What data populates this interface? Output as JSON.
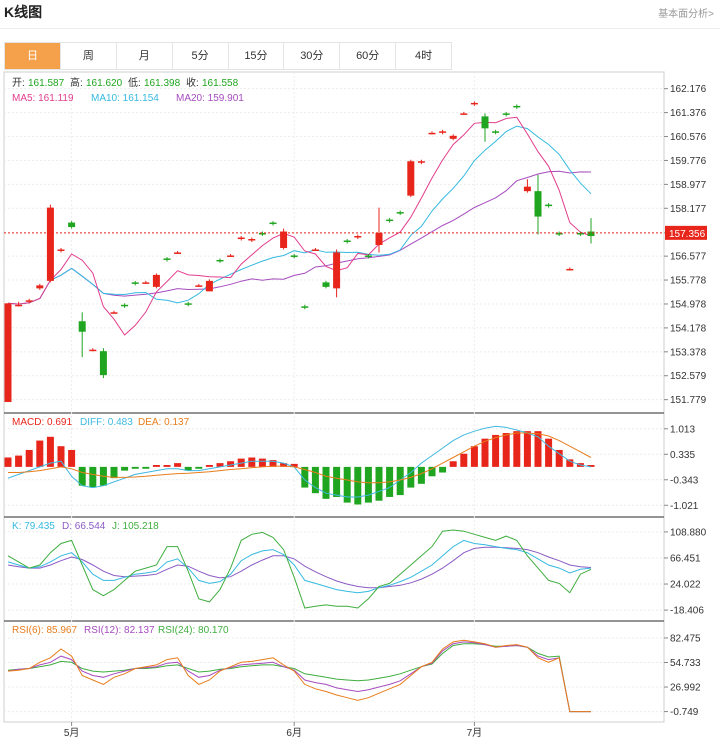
{
  "header": {
    "title": "K线图",
    "basic_link": "基本面分析>"
  },
  "tabs": [
    {
      "label": "日",
      "active": true
    },
    {
      "label": "周",
      "active": false
    },
    {
      "label": "月",
      "active": false
    },
    {
      "label": "5分",
      "active": false
    },
    {
      "label": "15分",
      "active": false
    },
    {
      "label": "30分",
      "active": false
    },
    {
      "label": "60分",
      "active": false
    },
    {
      "label": "4时",
      "active": false
    }
  ],
  "colors": {
    "up": "#e8251b",
    "down": "#1fa51f",
    "ma5": "#e23d8e",
    "ma10": "#35b9e0",
    "ma20": "#a64cbf",
    "macd": "#e8251b",
    "diff": "#3fb8e0",
    "dea": "#e87d1c",
    "k": "#35b9e0",
    "d": "#8b5bc4",
    "j": "#3fae3f",
    "rsi6": "#e87d1c",
    "rsi12": "#a64cbf",
    "rsi24": "#3fae3f"
  },
  "chart_data": [
    {
      "type": "candlestick",
      "legend_ohlc": {
        "open_label": "开:",
        "open": "161.587",
        "high_label": "高:",
        "high": "161.620",
        "low_label": "低:",
        "low": "161.398",
        "close_label": "收:",
        "close": "161.558"
      },
      "legend_ma": [
        {
          "label": "MA5: 161.119"
        },
        {
          "label": "MA10: 161.154"
        },
        {
          "label": "MA20: 159.901"
        }
      ],
      "y_ticks": [
        "162.176",
        "161.376",
        "160.576",
        "159.776",
        "158.977",
        "158.177",
        "157.356",
        "156.577",
        "155.778",
        "154.978",
        "154.178",
        "153.378",
        "152.579",
        "151.779"
      ],
      "y_tick_values": [
        162.176,
        161.376,
        160.576,
        159.776,
        158.977,
        158.177,
        157.356,
        156.577,
        155.778,
        154.978,
        154.178,
        153.378,
        152.579,
        151.779
      ],
      "current_price": 157.356,
      "ylim": [
        151.5,
        162.6
      ],
      "x_ticks": [
        {
          "label": "5月",
          "index": 6
        },
        {
          "label": "6月",
          "index": 27
        },
        {
          "label": "7月",
          "index": 44
        }
      ],
      "candles": [
        [
          151.7,
          155.0,
          151.7,
          155.0
        ],
        [
          154.95,
          154.95,
          154.9,
          155.05
        ],
        [
          155.05,
          155.1,
          155.0,
          155.15
        ],
        [
          155.5,
          155.6,
          155.45,
          155.65
        ],
        [
          155.75,
          158.2,
          155.7,
          158.3
        ],
        [
          156.75,
          156.8,
          156.7,
          156.85
        ],
        [
          157.7,
          157.55,
          157.5,
          157.75
        ],
        [
          154.4,
          154.05,
          153.2,
          154.7
        ],
        [
          153.4,
          153.45,
          153.4,
          153.5
        ],
        [
          153.4,
          152.6,
          152.5,
          153.5
        ],
        [
          154.65,
          154.7,
          154.65,
          154.75
        ],
        [
          154.95,
          154.9,
          154.85,
          155.0
        ],
        [
          155.7,
          155.65,
          155.6,
          155.75
        ],
        [
          155.65,
          155.7,
          155.65,
          155.75
        ],
        [
          155.55,
          155.95,
          155.5,
          156.0
        ],
        [
          156.5,
          156.45,
          156.4,
          156.55
        ],
        [
          156.65,
          156.7,
          156.65,
          156.75
        ],
        [
          155.0,
          154.95,
          154.9,
          155.05
        ],
        [
          155.55,
          155.6,
          155.55,
          155.65
        ],
        [
          155.4,
          155.75,
          155.4,
          155.8
        ],
        [
          156.45,
          156.4,
          156.35,
          156.5
        ],
        [
          156.55,
          156.6,
          156.55,
          156.65
        ],
        [
          157.15,
          157.2,
          157.1,
          157.25
        ],
        [
          157.1,
          157.15,
          157.05,
          157.2
        ],
        [
          157.35,
          157.3,
          157.25,
          157.4
        ],
        [
          157.7,
          157.65,
          157.6,
          157.75
        ],
        [
          156.85,
          157.4,
          156.8,
          157.5
        ],
        [
          156.6,
          156.55,
          156.5,
          156.65
        ],
        [
          154.9,
          154.85,
          154.8,
          154.95
        ],
        [
          156.75,
          156.8,
          156.75,
          156.85
        ],
        [
          155.7,
          155.55,
          155.5,
          155.75
        ],
        [
          155.5,
          156.7,
          155.2,
          156.8
        ],
        [
          157.1,
          157.05,
          157.0,
          157.15
        ],
        [
          157.2,
          157.25,
          157.15,
          157.3
        ],
        [
          156.6,
          156.55,
          156.5,
          156.65
        ],
        [
          156.95,
          157.35,
          156.7,
          158.2
        ],
        [
          157.8,
          157.75,
          157.7,
          157.85
        ],
        [
          158.05,
          158.0,
          157.95,
          158.1
        ],
        [
          158.6,
          159.75,
          158.55,
          159.8
        ],
        [
          159.7,
          159.75,
          159.65,
          159.8
        ],
        [
          160.65,
          160.7,
          160.65,
          160.75
        ],
        [
          160.7,
          160.75,
          160.65,
          160.8
        ],
        [
          160.5,
          160.6,
          160.45,
          160.65
        ],
        [
          161.3,
          161.35,
          161.3,
          161.4
        ],
        [
          161.65,
          161.7,
          161.6,
          161.75
        ],
        [
          161.25,
          160.85,
          160.4,
          161.35
        ],
        [
          160.75,
          160.7,
          160.65,
          160.8
        ],
        [
          161.35,
          161.3,
          161.25,
          161.4
        ],
        [
          161.6,
          161.55,
          161.5,
          161.65
        ],
        [
          158.75,
          158.9,
          158.7,
          159.15
        ],
        [
          158.75,
          157.9,
          157.3,
          159.3
        ],
        [
          158.3,
          158.25,
          158.2,
          158.35
        ],
        [
          157.35,
          157.3,
          157.25,
          157.4
        ],
        [
          156.15,
          156.15,
          156.1,
          156.2
        ],
        [
          157.35,
          157.3,
          157.25,
          157.4
        ],
        [
          157.4,
          157.25,
          157.0,
          157.85
        ]
      ]
    },
    {
      "type": "macd",
      "legend": [
        {
          "label": "MACD: 0.691"
        },
        {
          "label": "DIFF: 0.483"
        },
        {
          "label": "DEA: 0.137"
        }
      ],
      "y_ticks": [
        "1.013",
        "0.335",
        "-0.343",
        "-1.021"
      ],
      "y_tick_values": [
        1.013,
        0.335,
        -0.343,
        -1.021
      ],
      "ylim": [
        -1.2,
        1.3
      ],
      "macd": [
        0.25,
        0.3,
        0.45,
        0.7,
        0.8,
        0.55,
        0.45,
        -0.5,
        -0.55,
        -0.5,
        -0.3,
        -0.1,
        -0.05,
        -0.05,
        0.05,
        0.05,
        0.1,
        -0.1,
        -0.05,
        0.05,
        0.1,
        0.15,
        0.22,
        0.25,
        0.22,
        0.18,
        0.1,
        0.08,
        -0.55,
        -0.7,
        -0.85,
        -0.8,
        -0.95,
        -1.0,
        -0.95,
        -0.9,
        -0.8,
        -0.75,
        -0.55,
        -0.45,
        -0.25,
        -0.15,
        0.15,
        0.35,
        0.55,
        0.75,
        0.85,
        0.9,
        0.95,
        0.95,
        0.95,
        0.75,
        0.45,
        0.2,
        0.1,
        0.05,
        -0.15,
        0.05
      ],
      "diff": [
        -0.3,
        -0.2,
        -0.1,
        0.0,
        0.1,
        0.15,
        -0.25,
        -0.5,
        -0.55,
        -0.5,
        -0.4,
        -0.3,
        -0.2,
        -0.15,
        -0.1,
        -0.05,
        -0.05,
        -0.1,
        -0.1,
        -0.05,
        0.0,
        0.05,
        0.1,
        0.15,
        0.15,
        0.15,
        0.1,
        0.0,
        -0.35,
        -0.55,
        -0.7,
        -0.75,
        -0.8,
        -0.8,
        -0.75,
        -0.65,
        -0.55,
        -0.35,
        -0.15,
        0.1,
        0.3,
        0.5,
        0.7,
        0.85,
        0.95,
        1.03,
        1.08,
        1.05,
        0.98,
        0.9,
        0.8,
        0.55,
        0.35,
        0.15,
        0.05,
        0.0,
        0.02,
        0.03
      ],
      "dea": [
        -0.15,
        -0.15,
        -0.13,
        -0.1,
        -0.05,
        0.0,
        -0.05,
        -0.15,
        -0.2,
        -0.25,
        -0.28,
        -0.28,
        -0.27,
        -0.25,
        -0.22,
        -0.2,
        -0.18,
        -0.17,
        -0.15,
        -0.13,
        -0.1,
        -0.07,
        -0.05,
        -0.02,
        0.0,
        0.02,
        0.02,
        0.0,
        -0.07,
        -0.15,
        -0.25,
        -0.3,
        -0.35,
        -0.4,
        -0.42,
        -0.42,
        -0.4,
        -0.35,
        -0.28,
        -0.18,
        -0.05,
        0.1,
        0.25,
        0.4,
        0.55,
        0.68,
        0.78,
        0.85,
        0.9,
        0.9,
        0.88,
        0.82,
        0.7,
        0.55,
        0.4,
        0.25,
        0.1,
        0.03
      ]
    },
    {
      "type": "kdj",
      "legend": [
        {
          "label": "K: 79.435"
        },
        {
          "label": "D: 66.544"
        },
        {
          "label": "J: 105.218"
        }
      ],
      "y_ticks": [
        "108.880",
        "66.451",
        "24.022",
        "-18.406"
      ],
      "y_tick_values": [
        108.88,
        66.451,
        24.022,
        -18.406
      ],
      "ylim": [
        -28,
        125
      ],
      "k": [
        60,
        55,
        50,
        52,
        60,
        70,
        75,
        60,
        40,
        30,
        30,
        35,
        40,
        42,
        45,
        60,
        65,
        50,
        30,
        25,
        28,
        40,
        62,
        72,
        78,
        80,
        72,
        55,
        30,
        25,
        20,
        15,
        12,
        10,
        12,
        18,
        22,
        28,
        35,
        45,
        55,
        70,
        85,
        95,
        90,
        88,
        85,
        82,
        80,
        75,
        65,
        55,
        50,
        42,
        48,
        50
      ],
      "d": [
        55,
        52,
        50,
        50,
        55,
        62,
        68,
        64,
        55,
        45,
        38,
        36,
        37,
        38,
        40,
        48,
        55,
        53,
        45,
        38,
        34,
        36,
        45,
        55,
        63,
        70,
        70,
        65,
        53,
        44,
        36,
        29,
        24,
        20,
        18,
        18,
        20,
        22,
        26,
        32,
        40,
        50,
        62,
        75,
        82,
        84,
        84,
        83,
        82,
        80,
        75,
        68,
        62,
        55,
        52,
        51
      ],
      "j": [
        70,
        60,
        50,
        55,
        75,
        90,
        95,
        55,
        15,
        5,
        15,
        30,
        45,
        50,
        55,
        85,
        85,
        45,
        0,
        -5,
        15,
        50,
        95,
        105,
        108,
        100,
        80,
        35,
        -15,
        -12,
        -10,
        -12,
        -12,
        -15,
        0,
        20,
        25,
        40,
        55,
        70,
        85,
        110,
        112,
        110,
        105,
        100,
        95,
        102,
        95,
        70,
        50,
        30,
        25,
        10,
        40,
        48
      ]
    },
    {
      "type": "rsi",
      "legend": [
        {
          "label": "RSI(6): 85.967"
        },
        {
          "label": "RSI(12): 82.137"
        },
        {
          "label": "RSI(24): 80.170"
        }
      ],
      "y_ticks": [
        "82.475",
        "54.733",
        "26.992",
        "-0.749"
      ],
      "y_tick_values": [
        82.475,
        54.733,
        26.992,
        -0.749
      ],
      "ylim": [
        -8,
        96
      ],
      "rsi6": [
        45,
        46,
        48,
        55,
        60,
        70,
        62,
        40,
        35,
        30,
        38,
        42,
        48,
        50,
        52,
        58,
        60,
        40,
        30,
        35,
        45,
        50,
        55,
        56,
        58,
        60,
        52,
        45,
        30,
        25,
        22,
        18,
        15,
        12,
        15,
        20,
        25,
        30,
        40,
        50,
        55,
        70,
        78,
        80,
        78,
        76,
        72,
        74,
        75,
        72,
        60,
        55,
        60,
        -0.75,
        -0.75,
        -0.75
      ],
      "rsi12": [
        45,
        47,
        48,
        52,
        55,
        62,
        58,
        45,
        40,
        38,
        42,
        45,
        48,
        49,
        50,
        54,
        55,
        45,
        38,
        40,
        46,
        49,
        52,
        53,
        54,
        55,
        50,
        46,
        35,
        32,
        30,
        26,
        24,
        22,
        24,
        27,
        30,
        34,
        42,
        50,
        54,
        68,
        76,
        78,
        77,
        75,
        72,
        73,
        74,
        72,
        62,
        58,
        60,
        -0.75,
        -0.75,
        -0.75
      ],
      "rsi24": [
        46,
        47,
        48,
        50,
        52,
        56,
        55,
        48,
        45,
        44,
        45,
        46,
        48,
        48,
        49,
        51,
        52,
        48,
        44,
        45,
        47,
        48,
        50,
        51,
        52,
        52,
        50,
        48,
        42,
        40,
        38,
        36,
        35,
        34,
        35,
        37,
        39,
        42,
        46,
        50,
        53,
        65,
        74,
        76,
        76,
        75,
        73,
        73,
        74,
        72,
        65,
        61,
        62,
        -0.75,
        -0.75,
        -0.75
      ]
    }
  ]
}
